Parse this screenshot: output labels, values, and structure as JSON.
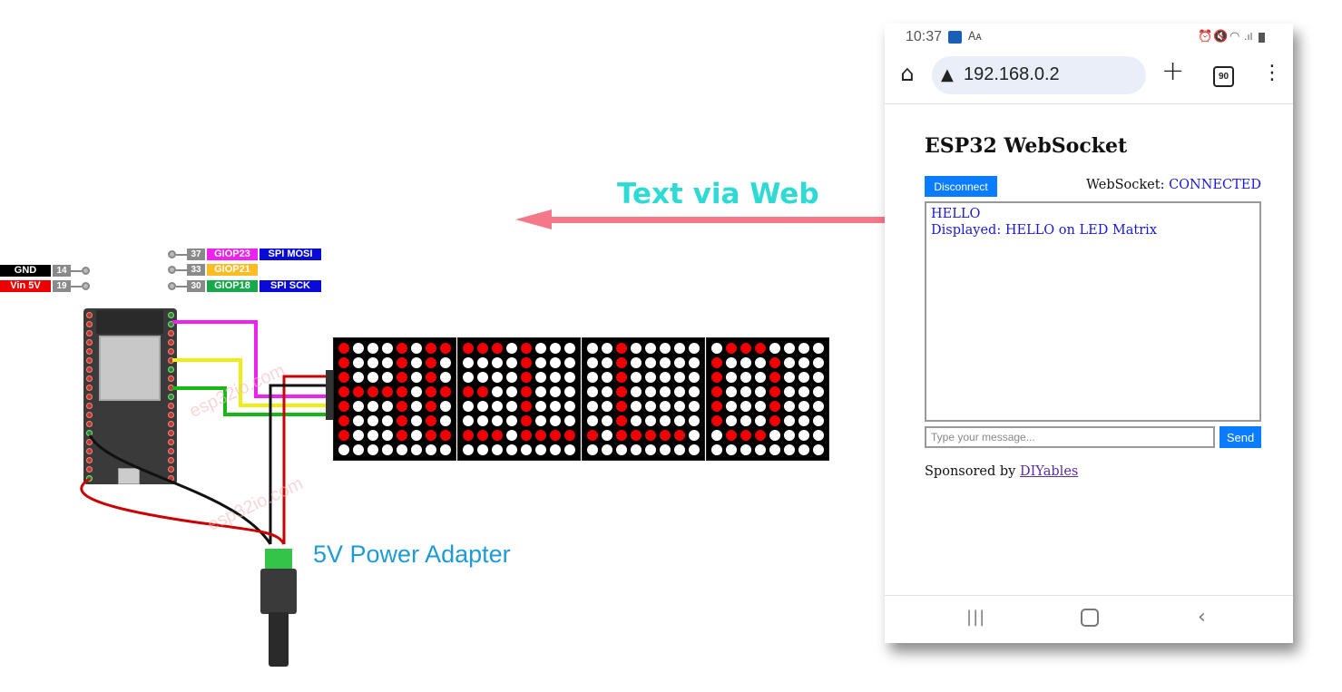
{
  "diagram": {
    "arrow_label": "Text via Web",
    "adapter_label": "5V Power Adapter",
    "watermark": "esp32io.com",
    "power_pins": [
      {
        "label": "GND",
        "pin": "14",
        "color": "#000000"
      },
      {
        "label": "Vin 5V",
        "pin": "19",
        "color": "#ee0000"
      }
    ],
    "signal_pins": [
      {
        "pin": "37",
        "gpio": "GIOP23",
        "gpio_color": "#ee22ee",
        "function": "SPI MOSI"
      },
      {
        "pin": "33",
        "gpio": "GIOP21",
        "gpio_color": "#ffbb22",
        "function": ""
      },
      {
        "pin": "30",
        "gpio": "GIOP18",
        "gpio_color": "#16a84a",
        "function": "SPI SCK"
      }
    ],
    "function_color": "#0a0ad6",
    "led_on_color": "#f00000",
    "led_off_color": "#ffffff",
    "matrices": [
      [
        "10001011",
        "10001010",
        "10001010",
        "11111011",
        "10001010",
        "10001010",
        "10001011",
        "00000000"
      ],
      [
        "11101000",
        "00001000",
        "00001000",
        "11001000",
        "00001000",
        "00001000",
        "11101111",
        "00000000"
      ],
      [
        "00100000",
        "00100000",
        "00100000",
        "00100000",
        "00100000",
        "00100000",
        "10111110",
        "00000000"
      ],
      [
        "01110000",
        "10001000",
        "10001000",
        "10001000",
        "10001000",
        "10001000",
        "01110000",
        "00000000"
      ]
    ]
  },
  "phone": {
    "status_bar": {
      "time": "10:37",
      "left_icons": [
        "app-notification-icon",
        "translate-icon"
      ],
      "right_icons": [
        "alarm-icon",
        "mute-icon",
        "wifi-icon",
        "signal-icon",
        "battery-icon"
      ]
    },
    "browser": {
      "url": "192.168.0.2",
      "tab_count": "90"
    },
    "page": {
      "title": "ESP32 WebSocket",
      "disconnect_label": "Disconnect",
      "ws_label": "WebSocket:",
      "ws_status": "CONNECTED",
      "log_lines": [
        "HELLO",
        "Displayed: HELLO on LED Matrix"
      ],
      "input_value": "",
      "input_placeholder": "Type your message...",
      "send_label": "Send",
      "sponsor_text": "Sponsored by",
      "sponsor_link": "DIYables"
    }
  }
}
